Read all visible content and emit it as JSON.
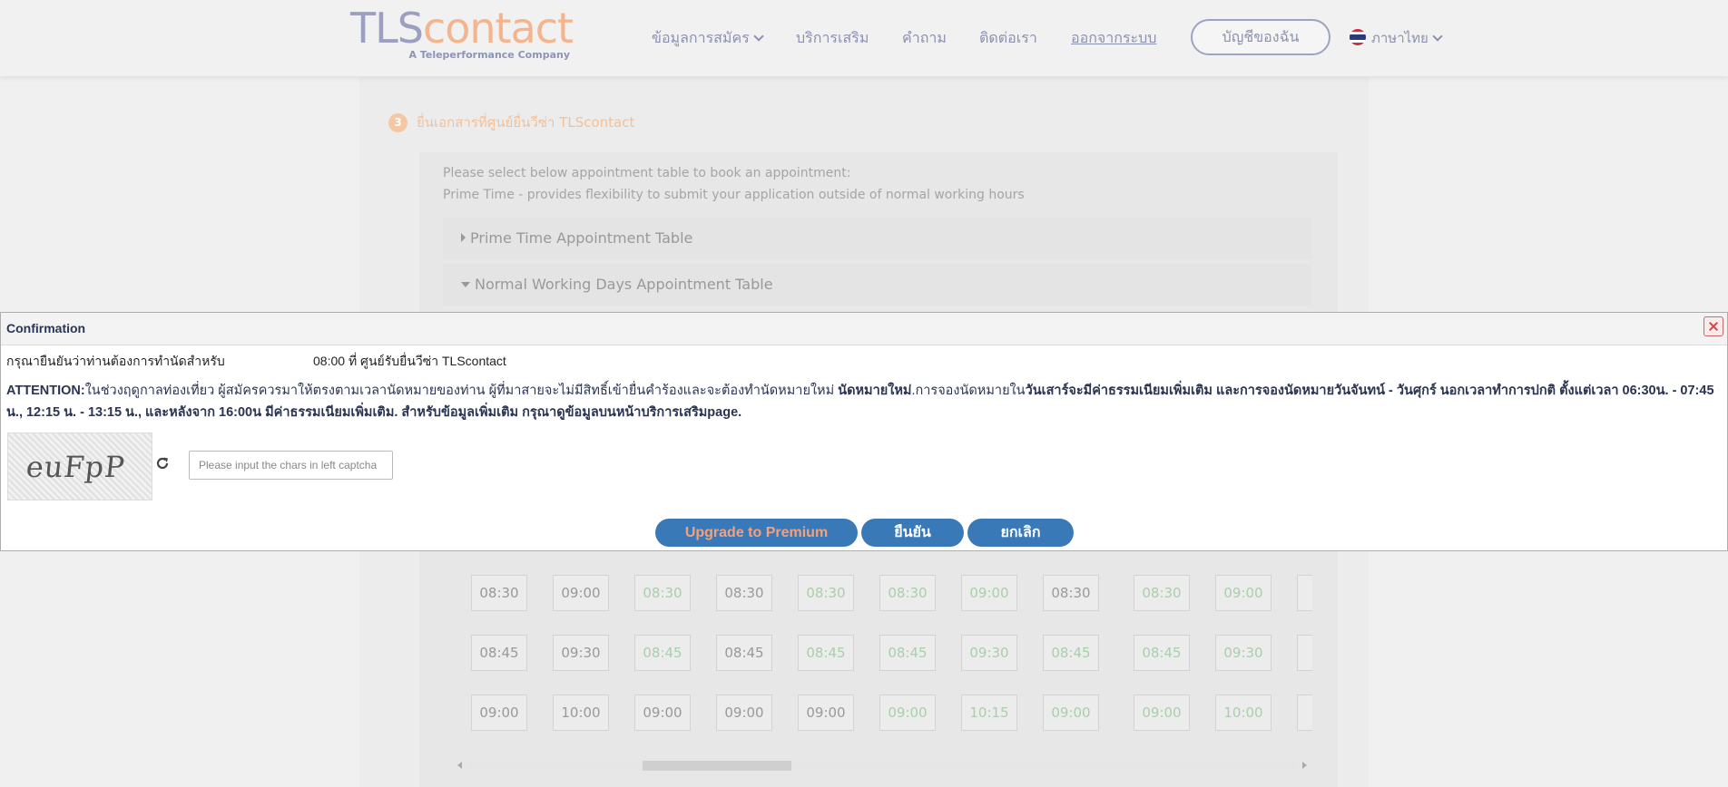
{
  "header": {
    "logo_tls": "TLS",
    "logo_contact": "contact",
    "logo_tagline": "A Teleperformance Company",
    "nav": {
      "application_info": "ข้อมูลการสมัคร",
      "extra_services": "บริการเสริม",
      "faq": "คำถาม",
      "contact": "ติดต่อเรา",
      "logout": "ออกจากระบบ"
    },
    "account_button": "บัญชีของฉัน",
    "language": "ภาษาไทย"
  },
  "page": {
    "step_number": "3",
    "step_title": "ยื่นเอกสารที่ศูนย์ยื่นวีซ่า TLScontact",
    "info_line_1": "Please select below appointment table to book an appointment:",
    "info_line_2": "Prime Time - provides flexibility to submit your application outside of normal working hours",
    "prime_time_table": "Prime Time Appointment Table",
    "normal_days_table": "Normal Working Days Appointment Table"
  },
  "slots": {
    "columns": [
      {
        "times": [
          "08:30",
          "08:45",
          "09:00"
        ],
        "available": false
      },
      {
        "times": [
          "09:00",
          "09:30",
          "10:00"
        ],
        "available": false
      },
      {
        "times": [
          "08:30",
          "08:45",
          "09:00"
        ],
        "available": [
          true,
          true,
          false
        ]
      },
      {
        "times": [
          "08:30",
          "08:45",
          "09:00"
        ],
        "available": false
      },
      {
        "times": [
          "08:30",
          "08:45",
          "09:00"
        ],
        "available": [
          true,
          true,
          false
        ]
      },
      {
        "times": [
          "08:30",
          "08:45",
          "09:00"
        ],
        "available": true
      },
      {
        "times": [
          "09:00",
          "09:30",
          "10:15"
        ],
        "available": true
      },
      {
        "times": [
          "08:30",
          "08:45",
          "09:00"
        ],
        "available": [
          false,
          true,
          true
        ]
      },
      {
        "times": [
          "08:30",
          "08:45",
          "09:00"
        ],
        "available": true
      },
      {
        "times": [
          "09:00",
          "09:30",
          "10:00"
        ],
        "available": true
      }
    ]
  },
  "dialog": {
    "title": "Confirmation",
    "confirm_text": "กรุณายืนยันว่าท่านต้องการทำนัดสำหรับ",
    "confirm_time": "08:00",
    "confirm_location": "ที่ ศูนย์รับยื่นวีซ่า TLScontact",
    "attention_label": "ATTENTION:",
    "attention_text_1": "ในช่วงฤดูกาลท่องเที่ยว ผู้สมัครควรมาให้ตรงตามเวลานัดหมายของท่าน ผู้ที่มาสายจะไม่มีสิทธิ์เข้ายื่นคำร้องและจะต้องทำนัดหมายใหม่ ",
    "attention_bold_1": "นัดหมายใหม่",
    "attention_text_2": ".การจองนัดหมายใน",
    "attention_bold_2": "วันเสาร์จะมีค่าธรรมเนียมเพิ่มเติม และการจองนัดหมายวันจันทน์ - วันศุกร์ นอกเวลาทำการปกติ ตั้งแต่เวลา 06:30น. - 07:45 น., 12:15 น. - 13:15 น., และหลังจาก 16:00น มีค่าธรรมเนียมเพิ่มเติม. สำหรับข้อมูลเพิ่มเติม กรุณาดูข้อมูลบนหน้าบริการเสริมpage.",
    "captcha_text": "euFpP",
    "captcha_placeholder": "Please input the chars in left captcha",
    "upgrade_button": "Upgrade to Premium",
    "confirm_button": "ยืนยัน",
    "cancel_button": "ยกเลิก"
  },
  "colors": {
    "accent_blue": "#3a79b8",
    "logo_purple": "#9c9fc1",
    "logo_orange": "#f4b58e",
    "slot_available": "#a9cfaa"
  },
  "icons": [
    "chevron-down-icon",
    "thai-flag-icon",
    "refresh-icon",
    "close-icon"
  ]
}
